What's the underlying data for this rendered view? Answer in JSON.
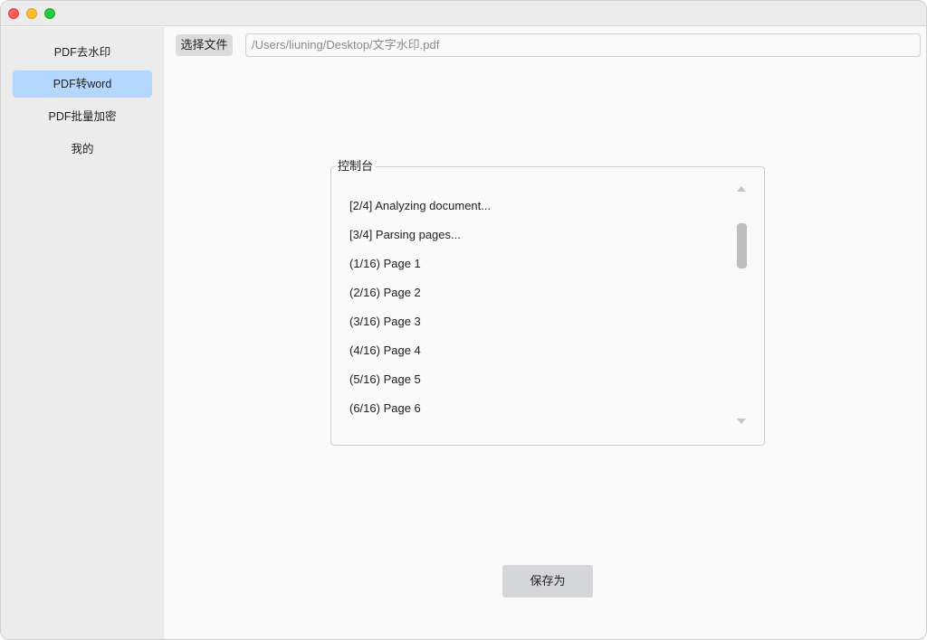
{
  "sidebar": {
    "items": [
      {
        "label": "PDF去水印",
        "active": false
      },
      {
        "label": "PDF转word",
        "active": true
      },
      {
        "label": "PDF批量加密",
        "active": false
      },
      {
        "label": "我的",
        "active": false
      }
    ]
  },
  "toolbar": {
    "choose_file_label": "选择文件",
    "file_path": "/Users/liuning/Desktop/文字水印.pdf"
  },
  "console": {
    "title": "控制台",
    "lines": [
      "[2/4] Analyzing document...",
      "[3/4] Parsing pages...",
      "(1/16) Page 1",
      "(2/16) Page 2",
      "(3/16) Page 3",
      "(4/16) Page 4",
      "(5/16) Page 5",
      "(6/16) Page 6"
    ]
  },
  "save_label": "保存为",
  "colors": {
    "active_item": "#b3d7ff",
    "sidebar_bg": "#ececec",
    "content_bg": "#fafafa",
    "button_bg": "#d4d6d9"
  }
}
